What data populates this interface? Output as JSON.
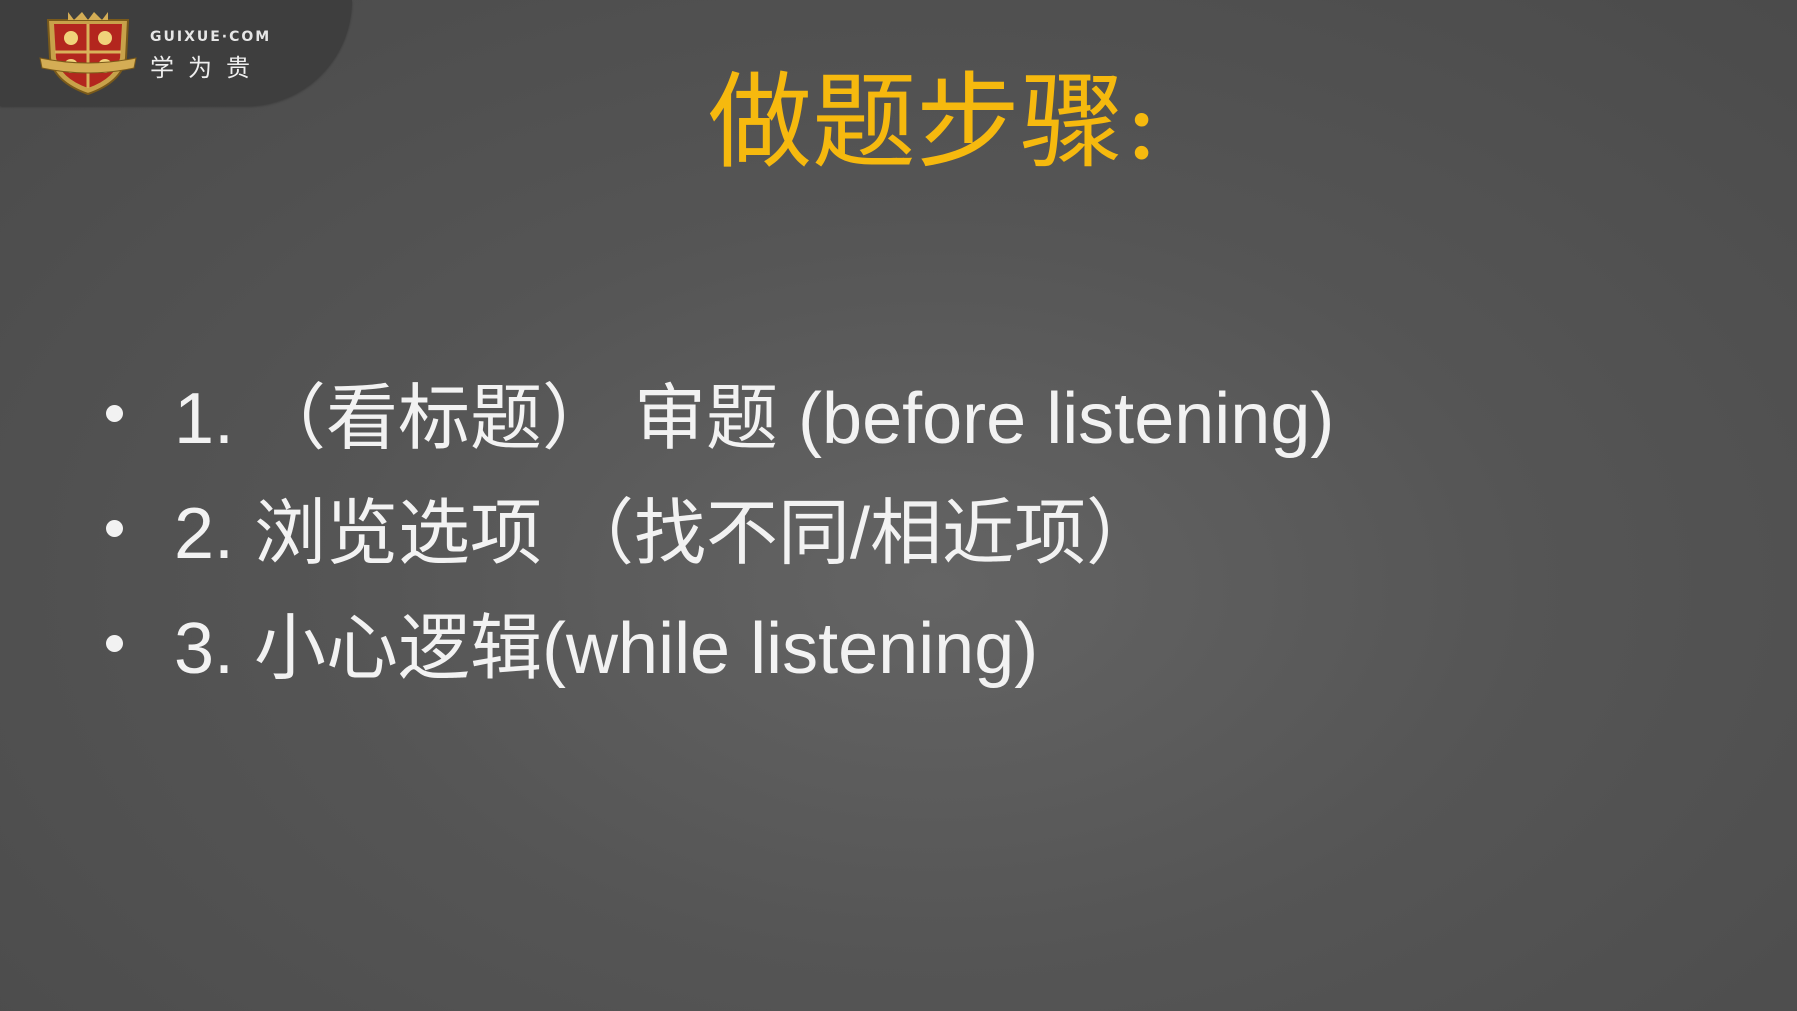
{
  "logo": {
    "site": "GUIXUE·COM",
    "name": "学为贵"
  },
  "slide": {
    "title": "做题步骤:",
    "bullets": [
      "1. （看标题） 审题 (before listening)",
      "2. 浏览选项 （找不同/相近项）",
      "3. 小心逻辑(while listening)"
    ]
  },
  "colors": {
    "title": "#f6b90e",
    "text": "#f2f2f2",
    "background": "#555555",
    "banner": "#3e3e3e"
  }
}
